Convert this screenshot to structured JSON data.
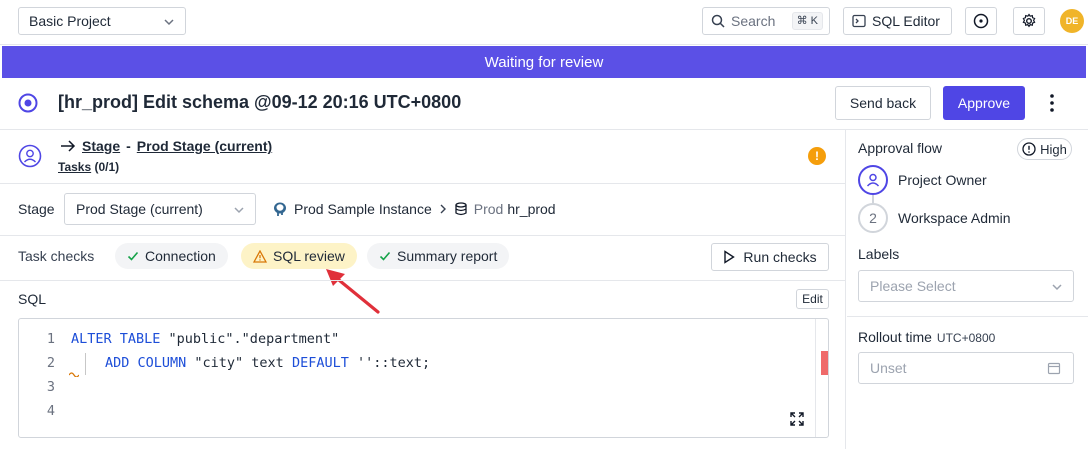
{
  "topbar": {
    "project": "Basic Project",
    "search_placeholder": "Search",
    "search_shortcut": "⌘ K",
    "sql_editor_label": "SQL Editor",
    "avatar_initials": "DE"
  },
  "banner": {
    "text": "Waiting for review"
  },
  "issue": {
    "title": "[hr_prod] Edit schema @09-12 20:16 UTC+0800",
    "send_back_label": "Send back",
    "approve_label": "Approve"
  },
  "pipeline": {
    "stage_prefix": "Stage",
    "stage_dash": "-",
    "stage_name": "Prod Stage (current)",
    "tasks_label": "Tasks",
    "tasks_count": "(0/1)"
  },
  "stage_row": {
    "label": "Stage",
    "selected": "Prod Stage (current)",
    "instance": "Prod Sample Instance",
    "db_env": "Prod",
    "db_name": "hr_prod"
  },
  "task_checks": {
    "label": "Task checks",
    "checks": [
      {
        "label": "Connection",
        "status": "success"
      },
      {
        "label": "SQL review",
        "status": "warning"
      },
      {
        "label": "Summary report",
        "status": "success"
      }
    ],
    "run_label": "Run checks"
  },
  "sql": {
    "label": "SQL",
    "edit_label": "Edit",
    "line_numbers": [
      "1",
      "2",
      "3",
      "4"
    ],
    "lines": [
      {
        "kw1": "ALTER TABLE",
        "rest": " \"public\".\"department\""
      },
      {
        "kw1": "ADD COLUMN",
        "mid": " \"city\" text ",
        "kw2": "DEFAULT",
        "rest": " ''::text;"
      }
    ]
  },
  "sidebar": {
    "approval_flow_label": "Approval flow",
    "risk_label": "High",
    "steps": [
      {
        "number": "",
        "label": "Project Owner"
      },
      {
        "number": "2",
        "label": "Workspace Admin"
      }
    ],
    "labels_title": "Labels",
    "labels_placeholder": "Please Select",
    "rollout_title": "Rollout time",
    "rollout_tz": "UTC+0800",
    "rollout_placeholder": "Unset"
  },
  "colors": {
    "accent": "#5b50e6",
    "approve": "#4f46e5",
    "warning": "#f59e0b",
    "success": "#16a34a",
    "annotation_arrow": "#e0303a"
  }
}
